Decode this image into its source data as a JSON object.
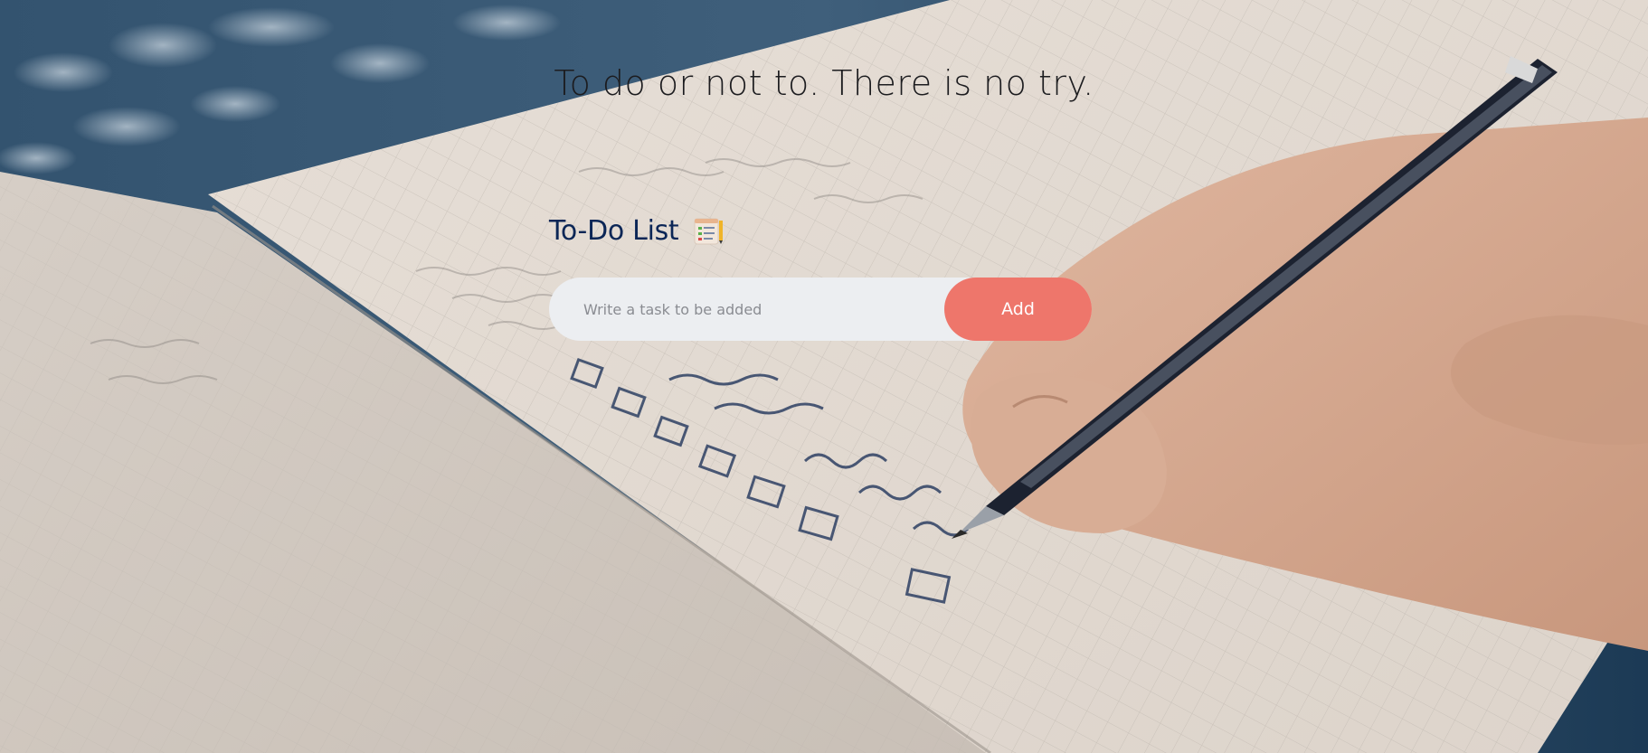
{
  "quote": "To do or not to. There is no try.",
  "todo": {
    "title": "To-Do List",
    "icon": "checklist-notepad-icon",
    "input_placeholder": "Write a task to be added",
    "input_value": "",
    "add_label": "Add"
  },
  "colors": {
    "title_text": "#0b2656",
    "add_button": "#ee766b",
    "input_bg": "#eceef1",
    "quote_text": "#1c1c1f"
  }
}
